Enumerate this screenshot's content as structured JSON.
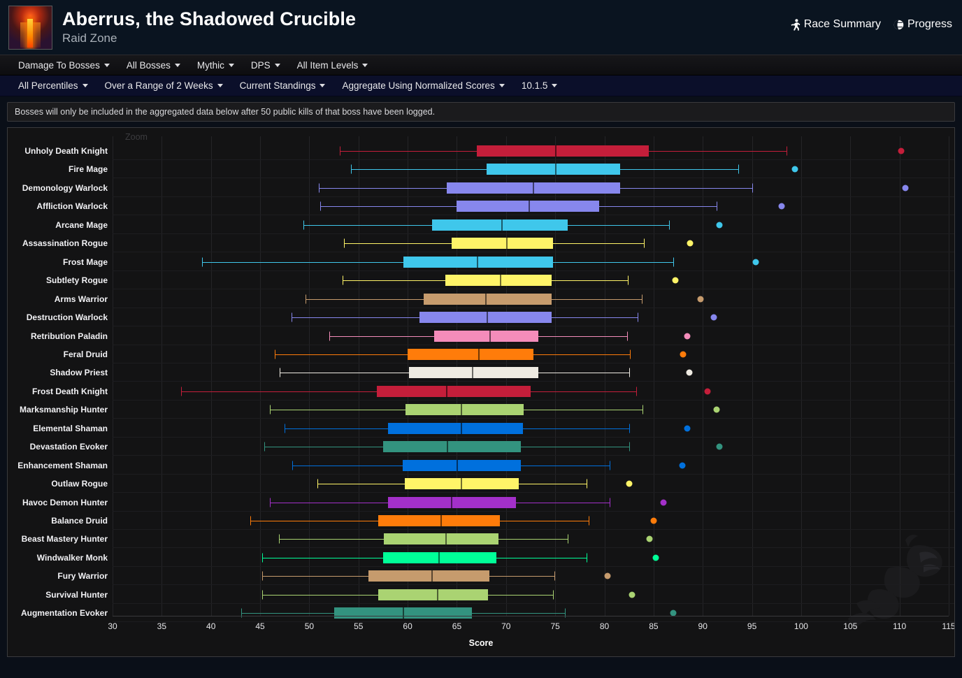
{
  "header": {
    "title": "Aberrus, the Shadowed Crucible",
    "subtitle": "Raid Zone",
    "links": [
      {
        "label": "Race Summary",
        "icon": "runner-icon"
      },
      {
        "label": "Progress",
        "icon": "globe-icon"
      }
    ]
  },
  "toolbar_primary": [
    {
      "label": "Damage To Bosses"
    },
    {
      "label": "All Bosses"
    },
    {
      "label": "Mythic"
    },
    {
      "label": "DPS"
    },
    {
      "label": "All Item Levels"
    }
  ],
  "toolbar_secondary": [
    {
      "label": "All Percentiles"
    },
    {
      "label": "Over a Range of 2 Weeks"
    },
    {
      "label": "Current Standings"
    },
    {
      "label": "Aggregate Using Normalized Scores"
    },
    {
      "label": "10.1.5"
    }
  ],
  "notice": "Bosses will only be included in the aggregated data below after 50 public kills of that boss have been logged.",
  "chart_controls": {
    "zoom_label": "Zoom"
  },
  "chart_data": {
    "type": "boxplot",
    "title": "",
    "xlabel": "Score",
    "ylabel": "",
    "xlim": [
      30,
      115
    ],
    "xticks": [
      30,
      35,
      40,
      45,
      50,
      55,
      60,
      65,
      70,
      75,
      80,
      85,
      90,
      95,
      100,
      105,
      110,
      115
    ],
    "grid": true,
    "legend": "none",
    "categories": [
      "Unholy Death Knight",
      "Fire Mage",
      "Demonology Warlock",
      "Affliction Warlock",
      "Arcane Mage",
      "Assassination Rogue",
      "Frost Mage",
      "Subtlety Rogue",
      "Arms Warrior",
      "Destruction Warlock",
      "Retribution Paladin",
      "Feral Druid",
      "Shadow Priest",
      "Frost Death Knight",
      "Marksmanship Hunter",
      "Elemental Shaman",
      "Devastation Evoker",
      "Enhancement Shaman",
      "Outlaw Rogue",
      "Havoc Demon Hunter",
      "Balance Druid",
      "Beast Mastery Hunter",
      "Windwalker Monk",
      "Fury Warrior",
      "Survival Hunter",
      "Augmentation Evoker"
    ],
    "boxes": [
      {
        "name": "Unholy Death Knight",
        "color": "#C41E3A",
        "whisker_low": 53.1,
        "q1": 67.0,
        "median": 75.0,
        "q3": 84.5,
        "whisker_high": 98.5,
        "outlier": 110.2
      },
      {
        "name": "Fire Mage",
        "color": "#3FC7EB",
        "whisker_low": 54.2,
        "q1": 68.0,
        "median": 75.0,
        "q3": 81.6,
        "whisker_high": 93.6,
        "outlier": 99.4
      },
      {
        "name": "Demonology Warlock",
        "color": "#8787ED",
        "whisker_low": 51.0,
        "q1": 64.0,
        "median": 72.7,
        "q3": 81.6,
        "whisker_high": 95.0,
        "outlier": 110.6
      },
      {
        "name": "Affliction Warlock",
        "color": "#8787ED",
        "whisker_low": 51.1,
        "q1": 65.0,
        "median": 72.3,
        "q3": 79.5,
        "whisker_high": 91.4,
        "outlier": 98.0
      },
      {
        "name": "Arcane Mage",
        "color": "#3FC7EB",
        "whisker_low": 49.4,
        "q1": 62.5,
        "median": 69.5,
        "q3": 76.3,
        "whisker_high": 86.6,
        "outlier": 91.7
      },
      {
        "name": "Assassination Rogue",
        "color": "#FFF468",
        "whisker_low": 53.5,
        "q1": 64.5,
        "median": 70.0,
        "q3": 74.8,
        "whisker_high": 84.0,
        "outlier": 88.7
      },
      {
        "name": "Frost Mage",
        "color": "#3FC7EB",
        "whisker_low": 39.1,
        "q1": 59.6,
        "median": 67.0,
        "q3": 74.8,
        "whisker_high": 87.0,
        "outlier": 95.4
      },
      {
        "name": "Subtlety Rogue",
        "color": "#FFF468",
        "whisker_low": 53.4,
        "q1": 63.8,
        "median": 69.4,
        "q3": 74.6,
        "whisker_high": 82.4,
        "outlier": 87.2
      },
      {
        "name": "Arms Warrior",
        "color": "#C69B6D",
        "whisker_low": 49.6,
        "q1": 61.6,
        "median": 67.9,
        "q3": 74.6,
        "whisker_high": 83.8,
        "outlier": 89.8
      },
      {
        "name": "Destruction Warlock",
        "color": "#8787ED",
        "whisker_low": 48.2,
        "q1": 61.2,
        "median": 68.0,
        "q3": 74.6,
        "whisker_high": 83.4,
        "outlier": 91.1
      },
      {
        "name": "Retribution Paladin",
        "color": "#F48CBA",
        "whisker_low": 52.0,
        "q1": 62.7,
        "median": 68.3,
        "q3": 73.3,
        "whisker_high": 82.3,
        "outlier": 88.4
      },
      {
        "name": "Feral Druid",
        "color": "#FF7C0A",
        "whisker_low": 46.5,
        "q1": 60.0,
        "median": 67.2,
        "q3": 72.8,
        "whisker_high": 82.6,
        "outlier": 88.0
      },
      {
        "name": "Shadow Priest",
        "color": "#EFEBE2",
        "whisker_low": 47.0,
        "q1": 60.1,
        "median": 66.5,
        "q3": 73.3,
        "whisker_high": 82.5,
        "outlier": 88.6
      },
      {
        "name": "Frost Death Knight",
        "color": "#C41E3A",
        "whisker_low": 37.0,
        "q1": 56.9,
        "median": 63.9,
        "q3": 72.5,
        "whisker_high": 83.2,
        "outlier": 90.5
      },
      {
        "name": "Marksmanship Hunter",
        "color": "#AAD372",
        "whisker_low": 46.0,
        "q1": 59.8,
        "median": 65.4,
        "q3": 71.8,
        "whisker_high": 83.9,
        "outlier": 91.4
      },
      {
        "name": "Elemental Shaman",
        "color": "#0070DD",
        "whisker_low": 47.5,
        "q1": 58.0,
        "median": 65.4,
        "q3": 71.7,
        "whisker_high": 82.5,
        "outlier": 88.4
      },
      {
        "name": "Devastation Evoker",
        "color": "#33937F",
        "whisker_low": 45.4,
        "q1": 57.5,
        "median": 64.0,
        "q3": 71.5,
        "whisker_high": 82.5,
        "outlier": 91.7
      },
      {
        "name": "Enhancement Shaman",
        "color": "#0070DD",
        "whisker_low": 48.3,
        "q1": 59.5,
        "median": 65.0,
        "q3": 71.5,
        "whisker_high": 80.5,
        "outlier": 87.9
      },
      {
        "name": "Outlaw Rogue",
        "color": "#FFF468",
        "whisker_low": 50.8,
        "q1": 59.7,
        "median": 65.4,
        "q3": 71.3,
        "whisker_high": 78.2,
        "outlier": 82.5
      },
      {
        "name": "Havoc Demon Hunter",
        "color": "#A330C9",
        "whisker_low": 46.0,
        "q1": 58.0,
        "median": 64.4,
        "q3": 71.0,
        "whisker_high": 80.5,
        "outlier": 86.0
      },
      {
        "name": "Balance Druid",
        "color": "#FF7C0A",
        "whisker_low": 44.0,
        "q1": 57.0,
        "median": 63.3,
        "q3": 69.4,
        "whisker_high": 78.4,
        "outlier": 85.0
      },
      {
        "name": "Beast Mastery Hunter",
        "color": "#AAD372",
        "whisker_low": 46.9,
        "q1": 57.6,
        "median": 63.8,
        "q3": 69.2,
        "whisker_high": 76.3,
        "outlier": 84.6
      },
      {
        "name": "Windwalker Monk",
        "color": "#00FF98",
        "whisker_low": 45.2,
        "q1": 57.5,
        "median": 63.1,
        "q3": 69.0,
        "whisker_high": 78.2,
        "outlier": 85.2
      },
      {
        "name": "Fury Warrior",
        "color": "#C69B6D",
        "whisker_low": 45.2,
        "q1": 56.0,
        "median": 62.4,
        "q3": 68.3,
        "whisker_high": 74.9,
        "outlier": 80.3
      },
      {
        "name": "Survival Hunter",
        "color": "#AAD372",
        "whisker_low": 45.2,
        "q1": 57.0,
        "median": 63.0,
        "q3": 68.2,
        "whisker_high": 74.8,
        "outlier": 82.8
      },
      {
        "name": "Augmentation Evoker",
        "color": "#33937F",
        "whisker_low": 43.1,
        "q1": 52.5,
        "median": 59.5,
        "q3": 66.5,
        "whisker_high": 76.0,
        "outlier": 87.0
      }
    ]
  }
}
